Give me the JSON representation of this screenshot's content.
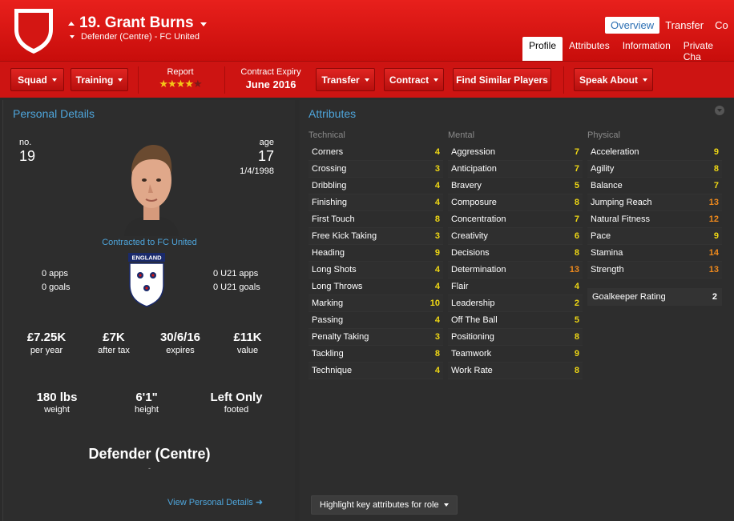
{
  "header": {
    "number_name": "19. Grant Burns",
    "subtitle": "Defender (Centre) - FC United",
    "tabs": [
      "Overview",
      "Transfer",
      "Co"
    ],
    "subtabs": [
      "Profile",
      "Attributes",
      "Information",
      "Private Cha"
    ]
  },
  "toolbar": {
    "squad": "Squad",
    "training": "Training",
    "report_label": "Report",
    "report_stars": 4,
    "contract_label": "Contract Expiry",
    "contract_value": "June 2016",
    "transfer": "Transfer",
    "contract": "Contract",
    "find_similar": "Find Similar Players",
    "speak_about": "Speak About"
  },
  "personal": {
    "title": "Personal Details",
    "no_label": "no.",
    "no_value": "19",
    "age_label": "age",
    "age_value": "17",
    "dob": "1/4/1998",
    "contracted": "Contracted to FC United",
    "badge_text": "ENGLAND",
    "apps": "0 apps",
    "goals": "0 goals",
    "u21_apps": "0 U21 apps",
    "u21_goals": "0 U21 goals",
    "wage": "£7.25K",
    "wage_label": "per year",
    "after_tax": "£7K",
    "after_tax_label": "after tax",
    "expires": "30/6/16",
    "expires_label": "expires",
    "value": "£11K",
    "value_label": "value",
    "weight": "180 lbs",
    "weight_label": "weight",
    "height": "6'1\"",
    "height_label": "height",
    "foot": "Left Only",
    "foot_label": "footed",
    "position": "Defender (Centre)",
    "position_sub": "-",
    "view_link": "View Personal Details"
  },
  "attributes": {
    "title": "Attributes",
    "technical_label": "Technical",
    "mental_label": "Mental",
    "physical_label": "Physical",
    "technical": [
      {
        "name": "Corners",
        "value": "4"
      },
      {
        "name": "Crossing",
        "value": "3"
      },
      {
        "name": "Dribbling",
        "value": "4"
      },
      {
        "name": "Finishing",
        "value": "4"
      },
      {
        "name": "First Touch",
        "value": "8"
      },
      {
        "name": "Free Kick Taking",
        "value": "3"
      },
      {
        "name": "Heading",
        "value": "9"
      },
      {
        "name": "Long Shots",
        "value": "4"
      },
      {
        "name": "Long Throws",
        "value": "4"
      },
      {
        "name": "Marking",
        "value": "10"
      },
      {
        "name": "Passing",
        "value": "4"
      },
      {
        "name": "Penalty Taking",
        "value": "3"
      },
      {
        "name": "Tackling",
        "value": "8"
      },
      {
        "name": "Technique",
        "value": "4"
      }
    ],
    "mental": [
      {
        "name": "Aggression",
        "value": "7"
      },
      {
        "name": "Anticipation",
        "value": "7"
      },
      {
        "name": "Bravery",
        "value": "5"
      },
      {
        "name": "Composure",
        "value": "8"
      },
      {
        "name": "Concentration",
        "value": "7"
      },
      {
        "name": "Creativity",
        "value": "6"
      },
      {
        "name": "Decisions",
        "value": "8"
      },
      {
        "name": "Determination",
        "value": "13"
      },
      {
        "name": "Flair",
        "value": "4"
      },
      {
        "name": "Leadership",
        "value": "2"
      },
      {
        "name": "Off The Ball",
        "value": "5"
      },
      {
        "name": "Positioning",
        "value": "8"
      },
      {
        "name": "Teamwork",
        "value": "9"
      },
      {
        "name": "Work Rate",
        "value": "8"
      }
    ],
    "physical": [
      {
        "name": "Acceleration",
        "value": "9"
      },
      {
        "name": "Agility",
        "value": "8"
      },
      {
        "name": "Balance",
        "value": "7"
      },
      {
        "name": "Jumping Reach",
        "value": "13"
      },
      {
        "name": "Natural Fitness",
        "value": "12"
      },
      {
        "name": "Pace",
        "value": "9"
      },
      {
        "name": "Stamina",
        "value": "14"
      },
      {
        "name": "Strength",
        "value": "13"
      }
    ],
    "gk_label": "Goalkeeper Rating",
    "gk_value": "2",
    "highlight_button": "Highlight key attributes for role"
  },
  "colors": {
    "header_red": "#d41613",
    "link_blue": "#4ea5db",
    "value_yellow": "#f0d814",
    "value_orange": "#f08a1c"
  }
}
